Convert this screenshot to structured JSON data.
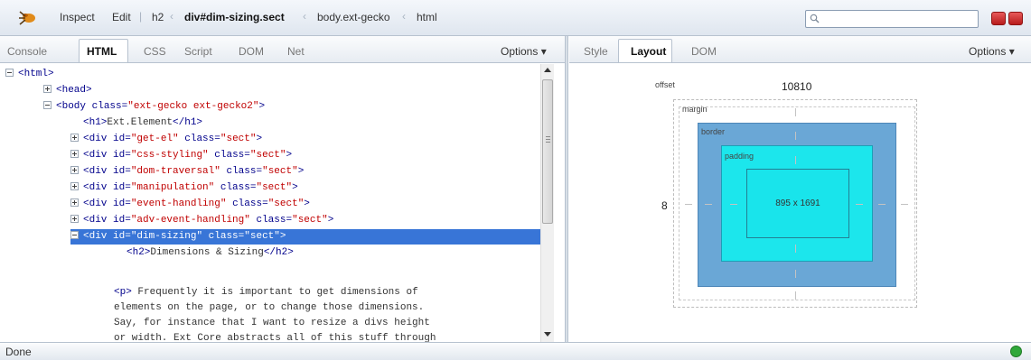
{
  "toolbar": {
    "inspect": "Inspect",
    "edit": "Edit",
    "breadcrumb": [
      "h2",
      "div#dim-sizing.sect",
      "body.ext-gecko",
      "html"
    ],
    "search_placeholder": ""
  },
  "left_tabs": [
    "Console",
    "HTML",
    "CSS",
    "Script",
    "DOM",
    "Net"
  ],
  "left_selected": "HTML",
  "left_options": "Options ▾",
  "right_tabs": [
    "Style",
    "Layout",
    "DOM"
  ],
  "right_selected": "Layout",
  "right_options": "Options ▾",
  "html_tree": [
    {
      "indent": 0,
      "toggle": "minus",
      "text": "<html>"
    },
    {
      "indent": 1,
      "toggle": "plus",
      "text": "<head>"
    },
    {
      "indent": 1,
      "toggle": "minus",
      "tag": "<body",
      "attrs": [
        {
          "name": "class",
          "value": "\"ext-gecko ext-gecko2\""
        }
      ],
      "tail": ">"
    },
    {
      "indent": 2,
      "toggle": "none",
      "tag": "<h1>",
      "text": "Ext.Element",
      "tail": "</h1>"
    },
    {
      "indent": 2,
      "toggle": "plus",
      "tag": "<div",
      "attrs": [
        {
          "name": "id",
          "value": "\"get-el\""
        },
        {
          "name": "class",
          "value": "\"sect\""
        }
      ],
      "tail": ">"
    },
    {
      "indent": 2,
      "toggle": "plus",
      "tag": "<div",
      "attrs": [
        {
          "name": "id",
          "value": "\"css-styling\""
        },
        {
          "name": "class",
          "value": "\"sect\""
        }
      ],
      "tail": ">"
    },
    {
      "indent": 2,
      "toggle": "plus",
      "tag": "<div",
      "attrs": [
        {
          "name": "id",
          "value": "\"dom-traversal\""
        },
        {
          "name": "class",
          "value": "\"sect\""
        }
      ],
      "tail": ">"
    },
    {
      "indent": 2,
      "toggle": "plus",
      "tag": "<div",
      "attrs": [
        {
          "name": "id",
          "value": "\"manipulation\""
        },
        {
          "name": "class",
          "value": "\"sect\""
        }
      ],
      "tail": ">"
    },
    {
      "indent": 2,
      "toggle": "plus",
      "tag": "<div",
      "attrs": [
        {
          "name": "id",
          "value": "\"event-handling\""
        },
        {
          "name": "class",
          "value": "\"sect\""
        }
      ],
      "tail": ">"
    },
    {
      "indent": 2,
      "toggle": "plus",
      "tag": "<div",
      "attrs": [
        {
          "name": "id",
          "value": "\"adv-event-handling\""
        },
        {
          "name": "class",
          "value": "\"sect\""
        }
      ],
      "tail": ">"
    },
    {
      "indent": 2,
      "toggle": "minus",
      "selected": true,
      "tag": "<div",
      "attrs": [
        {
          "name": "id",
          "value": "\"dim-sizing\""
        },
        {
          "name": "class",
          "value": "\"sect\""
        }
      ],
      "tail": ">"
    },
    {
      "indent": 3,
      "toggle": "none",
      "tag": "<h2>",
      "text": "Dimensions & Sizing",
      "tail": "</h2>"
    }
  ],
  "paragraph": {
    "tag": "<p>",
    "lines": [
      "Frequently it is important to get dimensions of",
      "elements on the page, or to change those dimensions.",
      "Say, for instance that I want to resize a divs height",
      "or width. Ext Core abstracts all of this stuff through"
    ]
  },
  "layout": {
    "offset_label": "offset",
    "offset_value": "10810",
    "margin_label": "margin",
    "border_label": "border",
    "padding_label": "padding",
    "left_value": "8",
    "content_size": "895 x 1691"
  },
  "status": "Done"
}
